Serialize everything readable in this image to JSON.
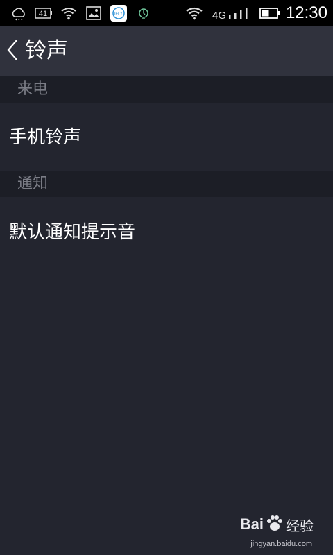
{
  "status_bar": {
    "time": "12:30",
    "network": "4G",
    "battery_badge": "41",
    "app_badge": "iFLY"
  },
  "header": {
    "title": "铃声"
  },
  "sections": [
    {
      "header": "来电",
      "items": [
        {
          "label": "手机铃声"
        }
      ]
    },
    {
      "header": "通知",
      "items": [
        {
          "label": "默认通知提示音"
        }
      ]
    }
  ],
  "watermark": {
    "brand_latin": "Bai",
    "brand_cn": "经验",
    "url": "jingyan.baidu.com"
  },
  "colors": {
    "background": "#23252f",
    "title_bar": "#30323d",
    "section_header": "#1c1e26",
    "status_bar": "#000000"
  }
}
